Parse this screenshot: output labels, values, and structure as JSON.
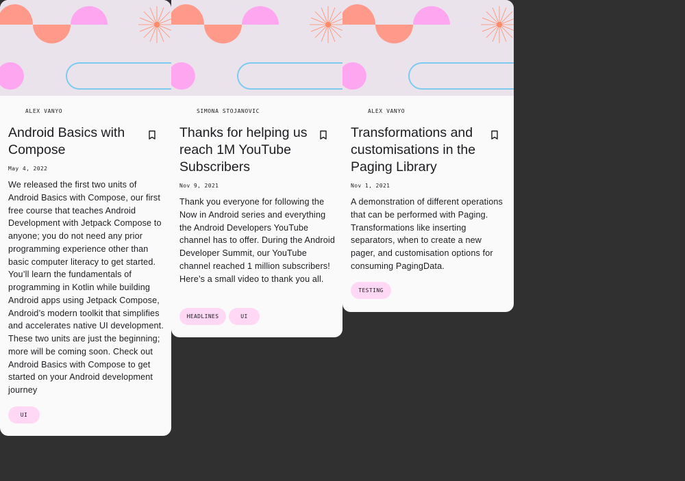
{
  "colors": {
    "background": "#303030",
    "card": "#fafafa",
    "header_bg": "#ebe3ec",
    "chip": "#ffd8f6",
    "shape_coral": "#ff9a8b",
    "shape_pink": "#ffa6f0",
    "shape_blue": "#7ccbef",
    "sunburst": "#ff8a6a"
  },
  "cards": [
    {
      "author": "ALEX VANYO",
      "title": "Android Basics with Compose",
      "bookmark_icon": "bookmark-outline-icon",
      "date": "May 4, 2022",
      "body": "We released the first two units of Android Basics with Compose, our first free course that teaches Android Development with Jetpack Compose to anyone; you do not need any prior programming experience other than basic computer literacy to get started. You’ll learn the fundamentals of programming in Kotlin while building Android apps using Jetpack Compose, Android’s modern toolkit that simplifies and accelerates native UI development. These two units are just the beginning; more will be coming soon. Check out Android Basics with Compose to get started on your Android development journey",
      "topics": [
        "UI"
      ]
    },
    {
      "author": "SIMONA STOJANOVIC",
      "title": "Thanks for helping us reach 1M YouTube Subscribers",
      "bookmark_icon": "bookmark-outline-icon",
      "date": "Nov 9, 2021",
      "body": "Thank you everyone for following the Now in Android series and everything the Android Developers YouTube channel has to offer. During the Android Developer Summit, our YouTube channel reached 1 million subscribers! Here’s a small video to thank you all.",
      "topics": [
        "HEADLINES",
        "UI"
      ]
    },
    {
      "author": "ALEX VANYO",
      "title": "Transformations and customisations in the Paging Library",
      "bookmark_icon": "bookmark-outline-icon",
      "date": "Nov 1, 2021",
      "body": "A demonstration of different operations that can be performed with Paging. Transformations like inserting separators, when to create a new pager, and customisation options for consuming PagingData.",
      "topics": [
        "TESTING"
      ]
    }
  ]
}
